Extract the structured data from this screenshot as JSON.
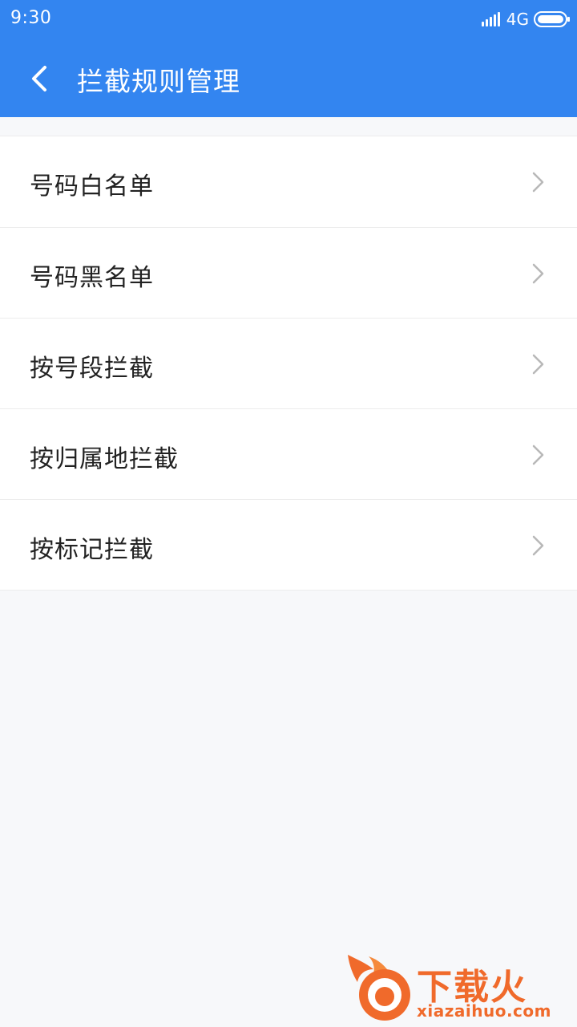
{
  "status_bar": {
    "time": "9:30",
    "network": "4G",
    "signal_icon": "signal-bars-icon",
    "battery_icon": "battery-icon"
  },
  "header": {
    "title": "拦截规则管理",
    "back_icon": "chevron-left-icon",
    "background_color": "#3385f0"
  },
  "menu": {
    "items": [
      {
        "label": "号码白名单"
      },
      {
        "label": "号码黑名单"
      },
      {
        "label": "按号段拦截"
      },
      {
        "label": "按归属地拦截"
      },
      {
        "label": "按标记拦截"
      }
    ],
    "chevron_icon": "chevron-right-icon"
  },
  "watermark": {
    "title": "下载火",
    "url": "xiazaihuo.com",
    "color": "#f06a2b"
  }
}
